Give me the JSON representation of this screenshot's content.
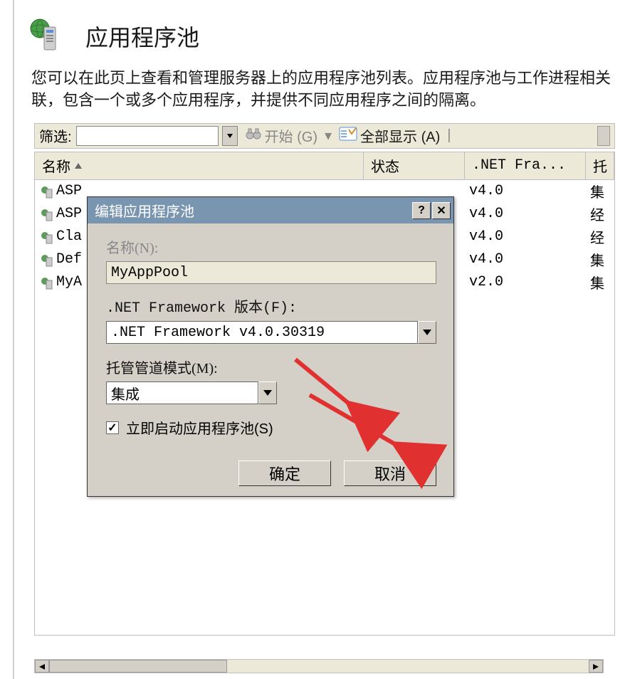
{
  "header": {
    "title": "应用程序池"
  },
  "description": "您可以在此页上查看和管理服务器上的应用程序池列表。应用程序池与工作进程相关联，包含一个或多个应用程序，并提供不同应用程序之间的隔离。",
  "toolbar": {
    "filter_label": "筛选:",
    "go_label": "开始 (G)",
    "showall_label": "全部显示 (A)"
  },
  "table": {
    "columns": {
      "name": "名称",
      "status": "状态",
      "net": ".NET Fra...",
      "managed": "托"
    },
    "rows": [
      {
        "name": "ASP",
        "net": "v4.0",
        "managed": "集"
      },
      {
        "name": "ASP",
        "net": "v4.0",
        "managed": "经"
      },
      {
        "name": "Cla",
        "net": "v4.0",
        "managed": "经"
      },
      {
        "name": "Def",
        "net": "v4.0",
        "managed": "集"
      },
      {
        "name": "MyA",
        "net": "v2.0",
        "managed": "集"
      }
    ]
  },
  "dialog": {
    "title": "编辑应用程序池",
    "name_label": "名称(N):",
    "name_value": "MyAppPool",
    "framework_label": ".NET Framework 版本(F):",
    "framework_value": ".NET Framework v4.0.30319",
    "mode_label": "托管管道模式(M):",
    "mode_value": "集成",
    "autostart_label": "立即启动应用程序池(S)",
    "ok": "确定",
    "cancel": "取消"
  }
}
